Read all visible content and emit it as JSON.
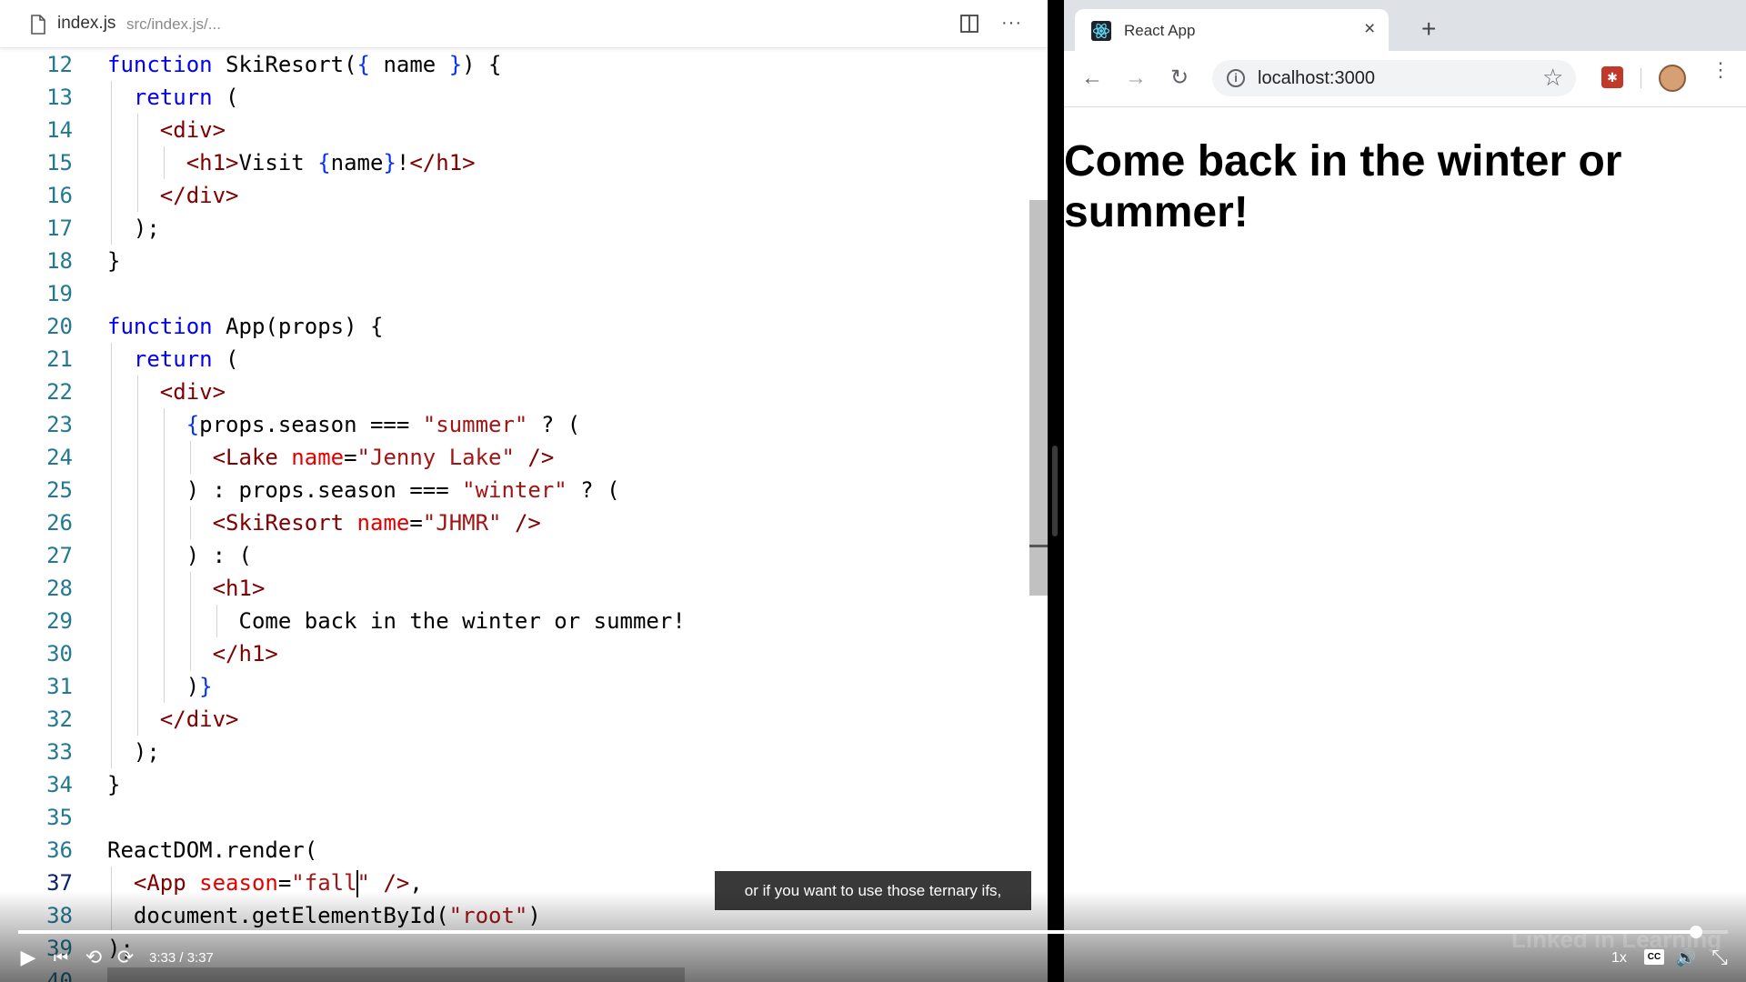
{
  "editor": {
    "tab": {
      "filename": "index.js",
      "path": "src/index.js/..."
    },
    "icons": {
      "file": "file-icon",
      "split": "split-editor-icon",
      "more": "more-actions-icon"
    },
    "active_line": "37",
    "lines": [
      {
        "n": "12",
        "tokens": [
          [
            "kw",
            "function"
          ],
          [
            "pl",
            " SkiResort("
          ],
          [
            "br",
            "{"
          ],
          [
            "pl",
            " name "
          ],
          [
            "br",
            "}"
          ],
          [
            "pl",
            ") {"
          ]
        ]
      },
      {
        "n": "13",
        "tokens": [
          [
            "kw",
            "return"
          ],
          [
            "pl",
            " ("
          ]
        ]
      },
      {
        "n": "14",
        "tokens": [
          [
            "tag",
            "<div>"
          ]
        ]
      },
      {
        "n": "15",
        "tokens": [
          [
            "tag",
            "<h1>"
          ],
          [
            "pl",
            "Visit "
          ],
          [
            "br",
            "{"
          ],
          [
            "pl",
            "name"
          ],
          [
            "br",
            "}"
          ],
          [
            "pl",
            "!"
          ],
          [
            "tag",
            "</h1>"
          ]
        ]
      },
      {
        "n": "16",
        "tokens": [
          [
            "tag",
            "</div>"
          ]
        ]
      },
      {
        "n": "17",
        "tokens": [
          [
            "pl",
            ");"
          ]
        ]
      },
      {
        "n": "18",
        "tokens": [
          [
            "pl",
            "}"
          ]
        ]
      },
      {
        "n": "19",
        "tokens": []
      },
      {
        "n": "20",
        "tokens": [
          [
            "kw",
            "function"
          ],
          [
            "pl",
            " App(props) {"
          ]
        ]
      },
      {
        "n": "21",
        "tokens": [
          [
            "kw",
            "return"
          ],
          [
            "pl",
            " ("
          ]
        ]
      },
      {
        "n": "22",
        "tokens": [
          [
            "tag",
            "<div>"
          ]
        ]
      },
      {
        "n": "23",
        "tokens": [
          [
            "br",
            "{"
          ],
          [
            "pl",
            "props.season === "
          ],
          [
            "str",
            "\"summer\""
          ],
          [
            "pl",
            " ? ("
          ]
        ]
      },
      {
        "n": "24",
        "tokens": [
          [
            "tag",
            "<Lake"
          ],
          [
            "pl",
            " "
          ],
          [
            "attr",
            "name"
          ],
          [
            "pl",
            "="
          ],
          [
            "str",
            "\"Jenny Lake\""
          ],
          [
            "pl",
            " "
          ],
          [
            "tag",
            "/>"
          ]
        ]
      },
      {
        "n": "25",
        "tokens": [
          [
            "pl",
            ") : props.season === "
          ],
          [
            "str",
            "\"winter\""
          ],
          [
            "pl",
            " ? ("
          ]
        ]
      },
      {
        "n": "26",
        "tokens": [
          [
            "tag",
            "<SkiResort"
          ],
          [
            "pl",
            " "
          ],
          [
            "attr",
            "name"
          ],
          [
            "pl",
            "="
          ],
          [
            "str",
            "\"JHMR\""
          ],
          [
            "pl",
            " "
          ],
          [
            "tag",
            "/>"
          ]
        ]
      },
      {
        "n": "27",
        "tokens": [
          [
            "pl",
            ") : ("
          ]
        ]
      },
      {
        "n": "28",
        "tokens": [
          [
            "tag",
            "<h1>"
          ]
        ]
      },
      {
        "n": "29",
        "tokens": [
          [
            "pl",
            "Come back in the winter or summer!"
          ]
        ]
      },
      {
        "n": "30",
        "tokens": [
          [
            "tag",
            "</h1>"
          ]
        ]
      },
      {
        "n": "31",
        "tokens": [
          [
            "pl",
            ")"
          ],
          [
            "br",
            "}"
          ]
        ]
      },
      {
        "n": "32",
        "tokens": [
          [
            "tag",
            "</div>"
          ]
        ]
      },
      {
        "n": "33",
        "tokens": [
          [
            "pl",
            ");"
          ]
        ]
      },
      {
        "n": "34",
        "tokens": [
          [
            "pl",
            "}"
          ]
        ]
      },
      {
        "n": "35",
        "tokens": []
      },
      {
        "n": "36",
        "tokens": [
          [
            "pl",
            "ReactDOM.render("
          ]
        ]
      },
      {
        "n": "37",
        "tokens": [
          [
            "tag",
            "<App"
          ],
          [
            "pl",
            " "
          ],
          [
            "attr",
            "season"
          ],
          [
            "pl",
            "="
          ],
          [
            "str",
            "\"fall"
          ],
          [
            "cursor",
            ""
          ],
          [
            "str",
            "\""
          ],
          [
            "pl",
            " "
          ],
          [
            "tag",
            "/>"
          ],
          [
            "pl",
            ","
          ]
        ]
      },
      {
        "n": "38",
        "tokens": [
          [
            "pl",
            "document.getElementById("
          ],
          [
            "str",
            "\"root\""
          ],
          [
            "pl",
            ")"
          ]
        ]
      },
      {
        "n": "39",
        "tokens": [
          [
            "pl",
            ");"
          ]
        ]
      },
      {
        "n": "40",
        "tokens": []
      }
    ]
  },
  "browser": {
    "tab_title": "React App",
    "tab_close": "×",
    "new_tab": "+",
    "url": "localhost:3000",
    "nav": {
      "back": "←",
      "forward": "→",
      "reload": "↻",
      "menu": "⋮",
      "star": "☆",
      "info": "i"
    },
    "page_heading": "Come back in the winter or summer!"
  },
  "caption": "or if you want to use those ternary ifs,",
  "player": {
    "time": "3:33 / 3:37",
    "progress": 0.9816,
    "speed": "1x",
    "cc": "CC",
    "watermark": "Linked in Learning",
    "icons": {
      "play": "▶",
      "prev": "⏮",
      "rewind": "⟲",
      "forward": "⟳",
      "volume": "🔊",
      "exit_fullscreen": "⤡"
    }
  },
  "colors": {
    "keyword": "#0000ff",
    "tag": "#800000",
    "attribute": "#e50000",
    "string": "#a31515",
    "bracket": "#0431fa",
    "line_number": "#237893"
  }
}
